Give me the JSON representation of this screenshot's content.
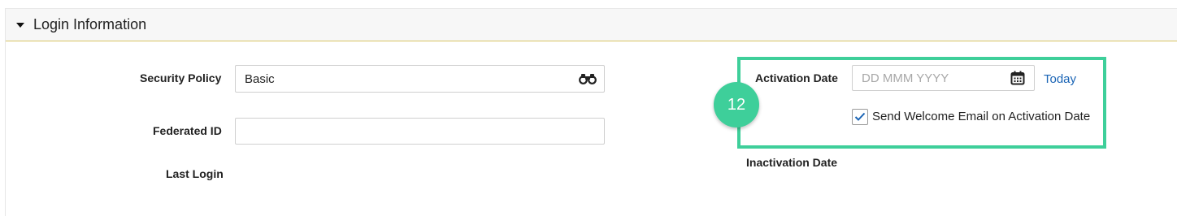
{
  "section": {
    "title": "Login Information",
    "collapse_icon": "caret-down-icon"
  },
  "fields": {
    "security_policy": {
      "label": "Security Policy",
      "value": "Basic",
      "icon": "binoculars-icon"
    },
    "federated_id": {
      "label": "Federated ID",
      "value": ""
    },
    "last_login": {
      "label": "Last Login"
    },
    "activation_date": {
      "label": "Activation Date",
      "placeholder": "DD MMM YYYY",
      "icon": "calendar-icon",
      "today_link": "Today"
    },
    "send_welcome_email": {
      "label": "Send Welcome Email on Activation Date",
      "checked": true
    },
    "inactivation_date": {
      "label": "Inactivation Date"
    }
  },
  "annotation": {
    "step_number": "12",
    "color": "#3ecf9a"
  }
}
